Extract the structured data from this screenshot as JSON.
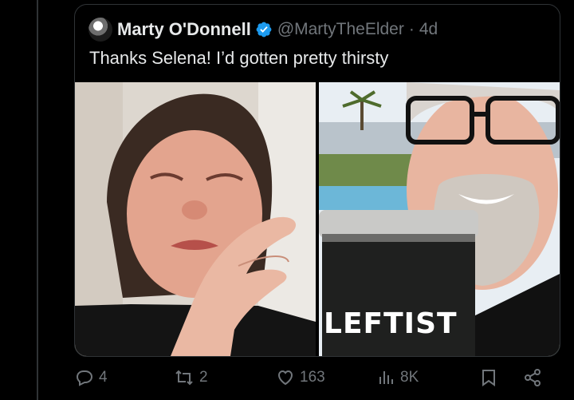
{
  "quote": {
    "display_name": "Marty O'Donnell",
    "handle": "@MartyTheElder",
    "separator": "·",
    "time": "4d",
    "text": "Thanks Selena! I’d gotten pretty thirsty",
    "verified_color": "#1d9bf0"
  },
  "media": {
    "right_photo_cup_text": "LEFTIST"
  },
  "actions": {
    "reply_count": "4",
    "repost_count": "2",
    "like_count": "163",
    "views_count": "8K"
  },
  "colors": {
    "background": "#000000",
    "text": "#e7e9ea",
    "muted": "#71767b",
    "border": "#2f3336"
  }
}
